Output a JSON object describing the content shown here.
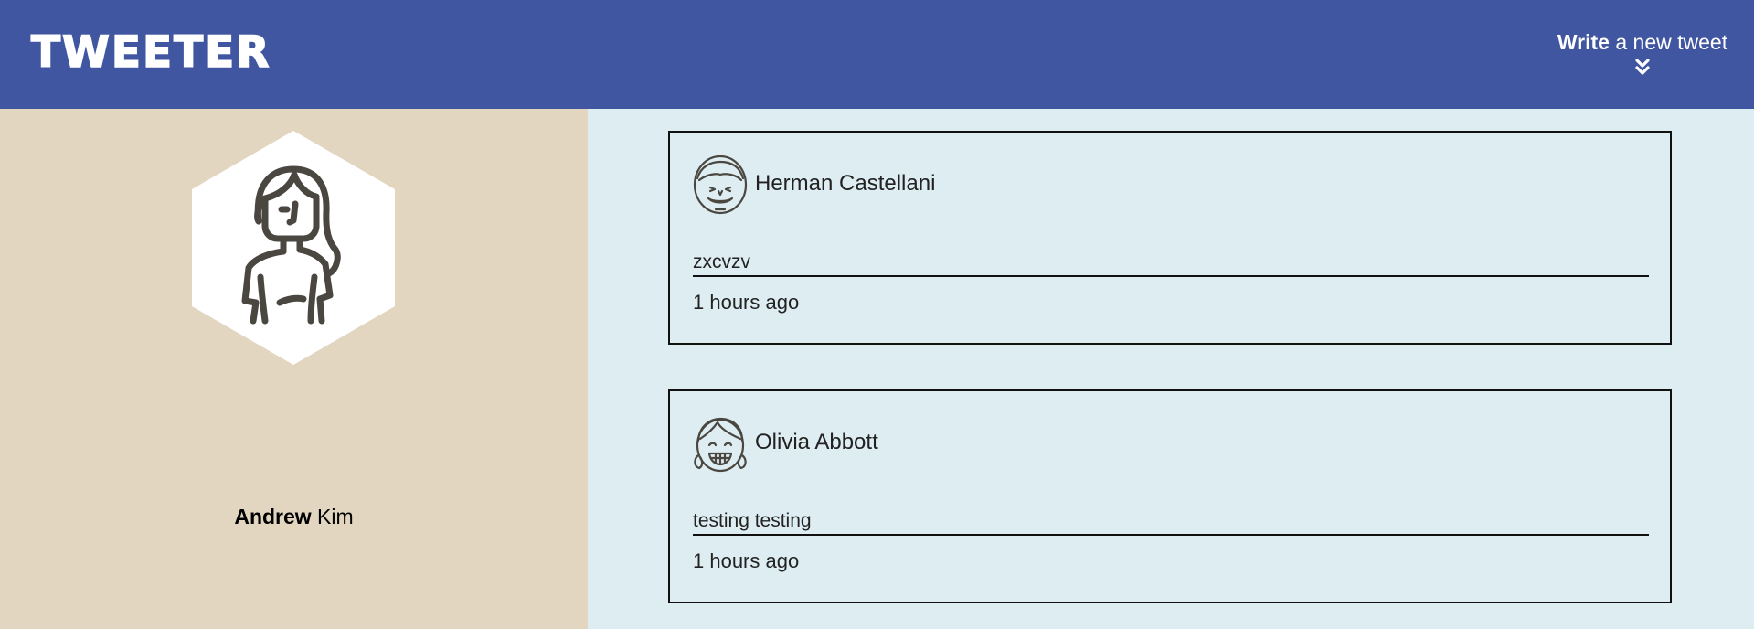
{
  "app": {
    "logo": "TWEETER"
  },
  "header": {
    "compose_bold": "Write",
    "compose_rest": " a new tweet",
    "compose_icon": "double-chevron-down-icon"
  },
  "profile": {
    "first_name": "Andrew",
    "last_name": " Kim",
    "avatar": "woman-avatar-icon"
  },
  "tweets": [
    {
      "author": "Herman Castellani",
      "avatar": "smiling-man-avatar-icon",
      "content": "zxcvzv",
      "time": "1 hours ago"
    },
    {
      "author": "Olivia Abbott",
      "avatar": "laughing-girl-avatar-icon",
      "content": "testing testing",
      "time": "1 hours ago"
    }
  ],
  "colors": {
    "header_bg": "#4056a1",
    "sidebar_bg": "#e2d6c0",
    "feed_bg": "#deedf2"
  }
}
